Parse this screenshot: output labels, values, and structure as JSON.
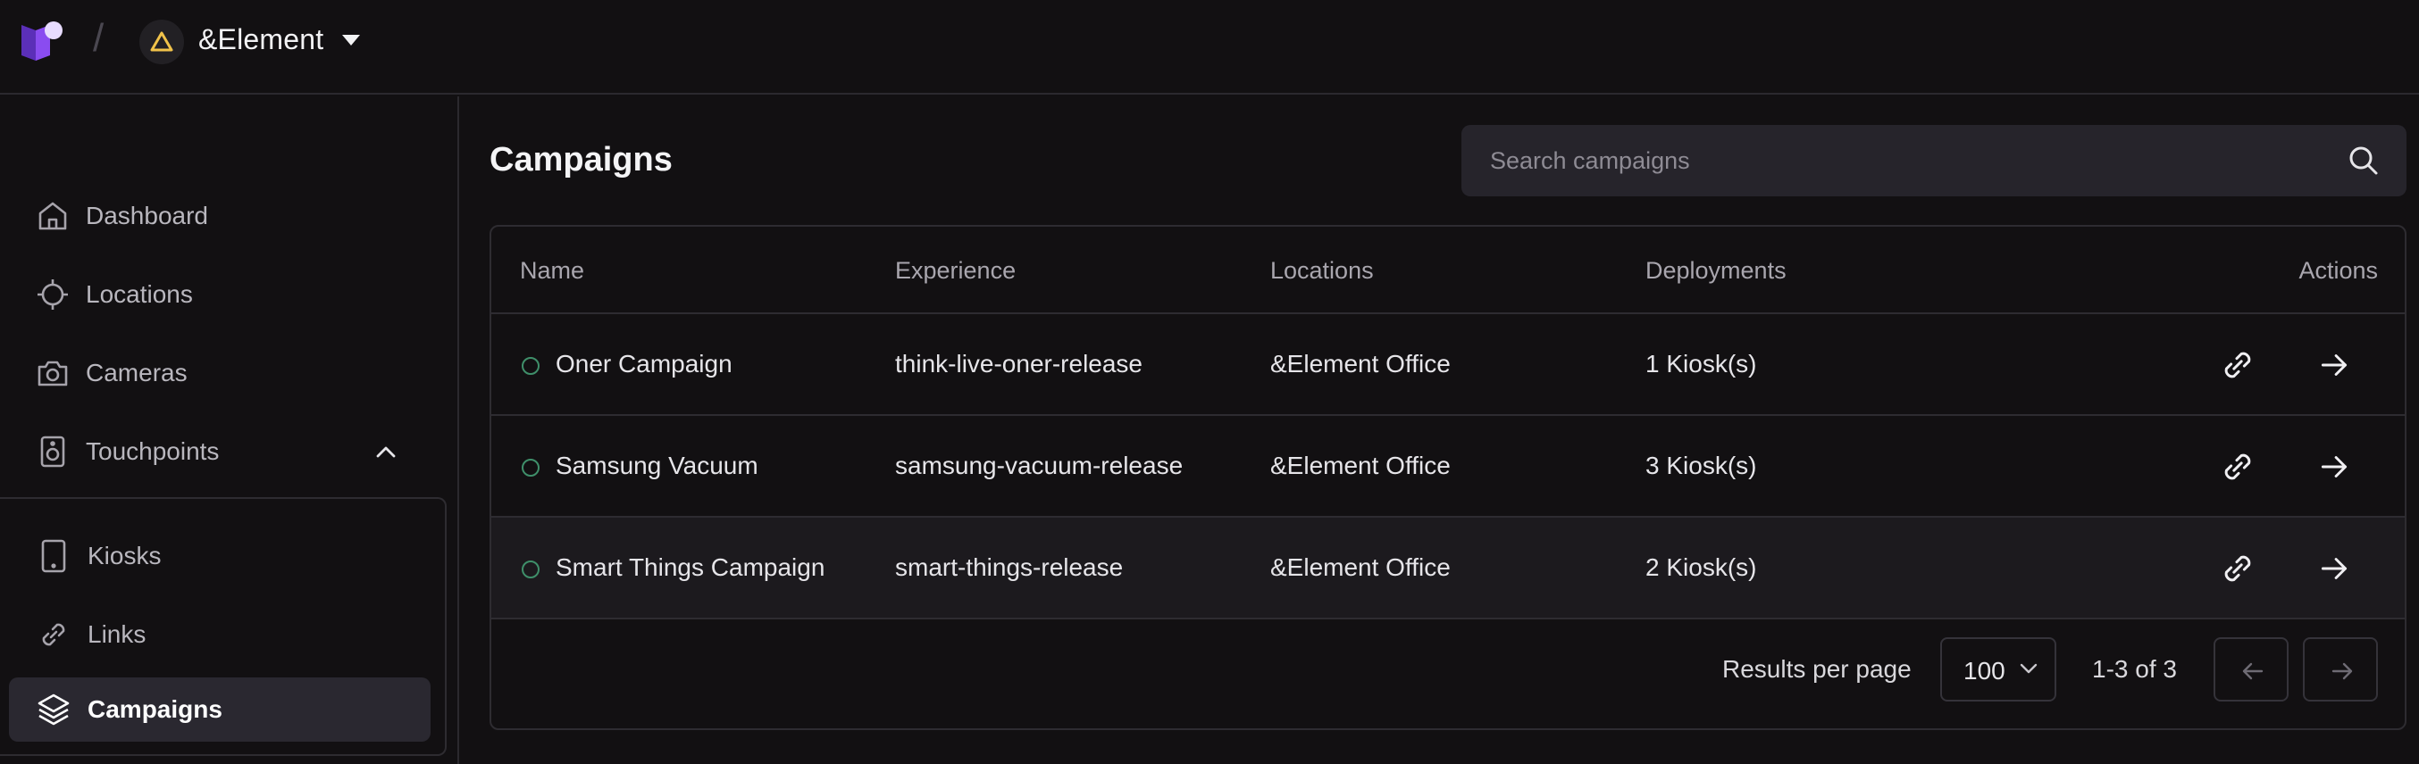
{
  "topbar": {
    "logo_icon": "brand-logo-icon",
    "org_icon": "triangle-icon",
    "org_name": "&Element"
  },
  "sidebar": {
    "items": [
      {
        "label": "Dashboard",
        "icon": "home-icon"
      },
      {
        "label": "Locations",
        "icon": "crosshair-icon"
      },
      {
        "label": "Cameras",
        "icon": "camera-icon"
      },
      {
        "label": "Touchpoints",
        "icon": "speaker-icon",
        "expanded": true
      }
    ],
    "subitems": [
      {
        "label": "Kiosks",
        "icon": "tablet-icon"
      },
      {
        "label": "Links",
        "icon": "link-icon"
      },
      {
        "label": "Campaigns",
        "icon": "layers-icon",
        "active": true
      }
    ]
  },
  "main": {
    "title": "Campaigns",
    "search": {
      "placeholder": "Search campaigns",
      "value": ""
    },
    "table": {
      "columns": [
        "Name",
        "Experience",
        "Locations",
        "Deployments",
        "Actions"
      ],
      "rows": [
        {
          "name": "Oner Campaign",
          "experience": "think-live-oner-release",
          "location": "&Element Office",
          "deployments": "1 Kiosk(s)"
        },
        {
          "name": "Samsung Vacuum",
          "experience": "samsung-vacuum-release",
          "location": "&Element Office",
          "deployments": "3 Kiosk(s)"
        },
        {
          "name": "Smart Things Campaign",
          "experience": "smart-things-release",
          "location": "&Element Office",
          "deployments": "2 Kiosk(s)"
        }
      ]
    },
    "pagination": {
      "results_per_page_label": "Results per page",
      "per_page": "100",
      "range": "1-3 of 3"
    }
  },
  "colors": {
    "background": "#121012",
    "status_active": "#3f8f6a",
    "brand": "#7b3fe4"
  }
}
